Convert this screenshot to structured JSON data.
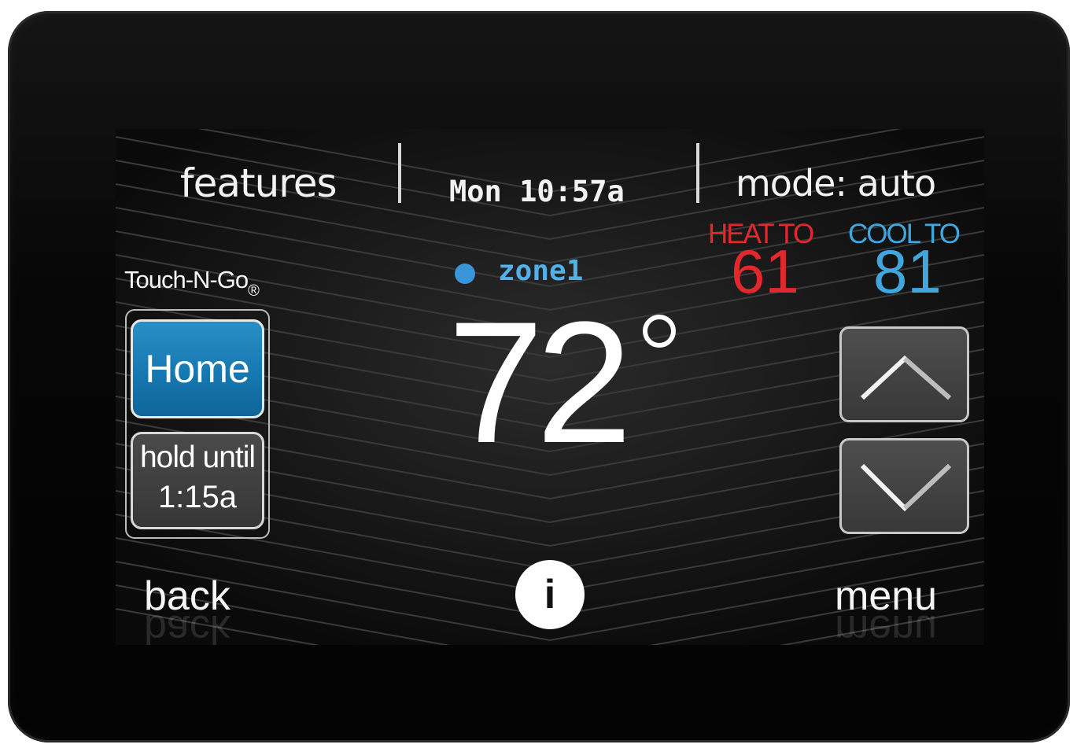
{
  "header": {
    "features_label": "features",
    "clock": "Mon 10:57a",
    "mode_label": "mode: auto"
  },
  "setpoints": {
    "heat_label": "HEAT TO",
    "heat_value": "61",
    "cool_label": "COOL TO",
    "cool_value": "81",
    "heat_color": "#e3282d",
    "cool_color": "#3fa7dd"
  },
  "zone": {
    "label": "zone1",
    "dot_color": "#3a95d8"
  },
  "brand": {
    "text": "Touch-N-Go",
    "mark": "®"
  },
  "temperature": {
    "value": "72"
  },
  "schedule": {
    "home_label": "Home",
    "hold_line1": "hold until",
    "hold_line2": "1:15a",
    "home_color": "#1a7fb8"
  },
  "controls": {
    "up_icon": "chevron-up-icon",
    "down_icon": "chevron-down-icon",
    "info_icon": "info-icon",
    "info_glyph": "i"
  },
  "footer": {
    "back_label": "back",
    "menu_label": "menu"
  }
}
